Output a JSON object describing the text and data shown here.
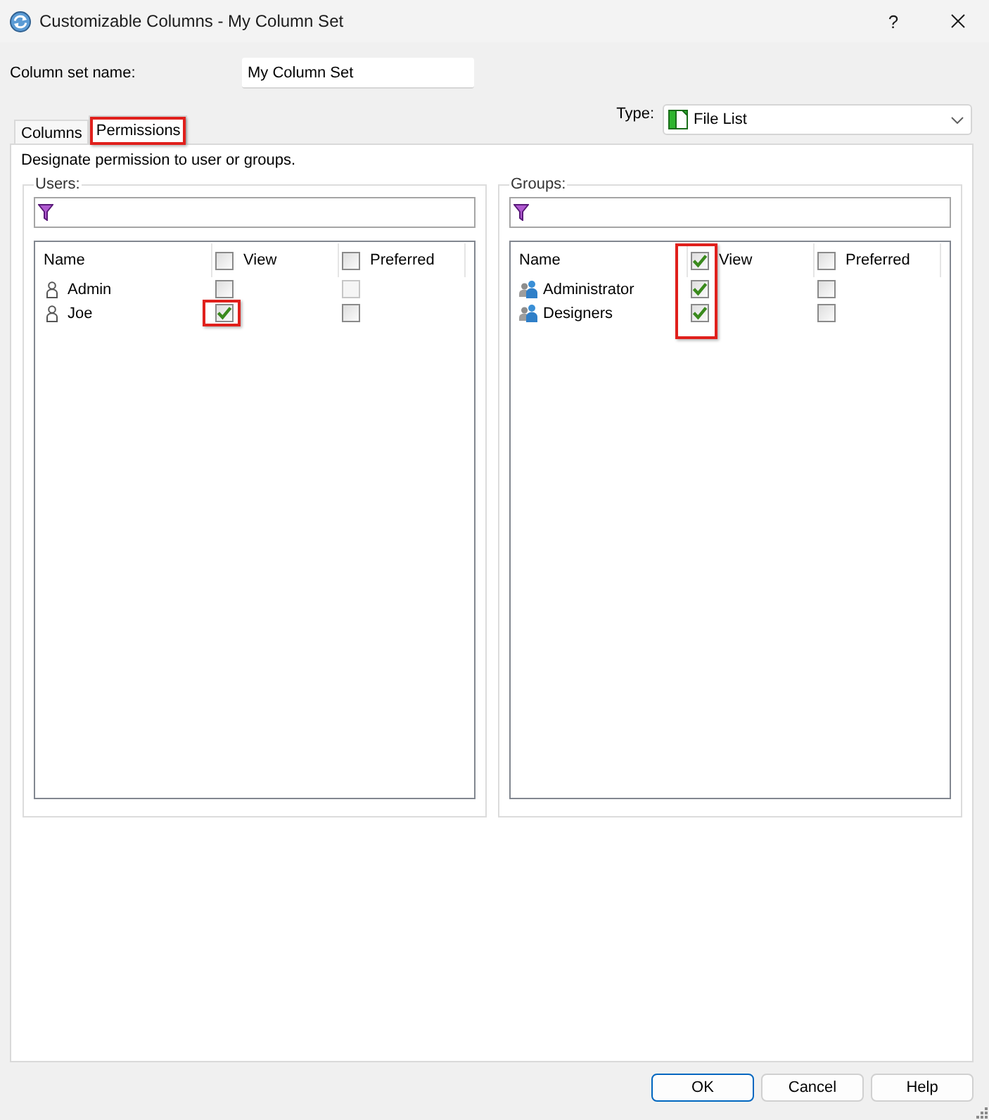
{
  "window": {
    "title": "Customizable Columns - My Column Set",
    "help_label": "?"
  },
  "column_set_name": {
    "label": "Column set name:",
    "value": "My Column Set"
  },
  "type": {
    "label": "Type:",
    "value": "File List"
  },
  "tabs": [
    {
      "label": "Columns",
      "selected": false,
      "highlighted": false
    },
    {
      "label": "Permissions",
      "selected": true,
      "highlighted": true
    }
  ],
  "description": "Designate permission to user or groups.",
  "panels": [
    {
      "kind": "users",
      "title": "Users:",
      "columns": {
        "name": "Name",
        "view": {
          "label": "View",
          "checked": false
        },
        "preferred": {
          "label": "Preferred",
          "checked": false
        }
      },
      "view_column_highlighted": false,
      "rows": [
        {
          "name": "Admin",
          "view": false,
          "view_highlighted": false,
          "preferred": false,
          "preferred_disabled": true
        },
        {
          "name": "Joe",
          "view": true,
          "view_highlighted": true,
          "preferred": false,
          "preferred_disabled": false
        }
      ]
    },
    {
      "kind": "groups",
      "title": "Groups:",
      "columns": {
        "name": "Name",
        "view": {
          "label": "View",
          "checked": true
        },
        "preferred": {
          "label": "Preferred",
          "checked": false
        }
      },
      "view_column_highlighted": true,
      "rows": [
        {
          "name": "Administrator",
          "view": true,
          "view_highlighted": false,
          "preferred": false,
          "preferred_disabled": false
        },
        {
          "name": "Designers",
          "view": true,
          "view_highlighted": false,
          "preferred": false,
          "preferred_disabled": false
        }
      ]
    }
  ],
  "buttons": [
    {
      "label": "OK",
      "default": true
    },
    {
      "label": "Cancel",
      "default": false
    },
    {
      "label": "Help",
      "default": false
    }
  ]
}
